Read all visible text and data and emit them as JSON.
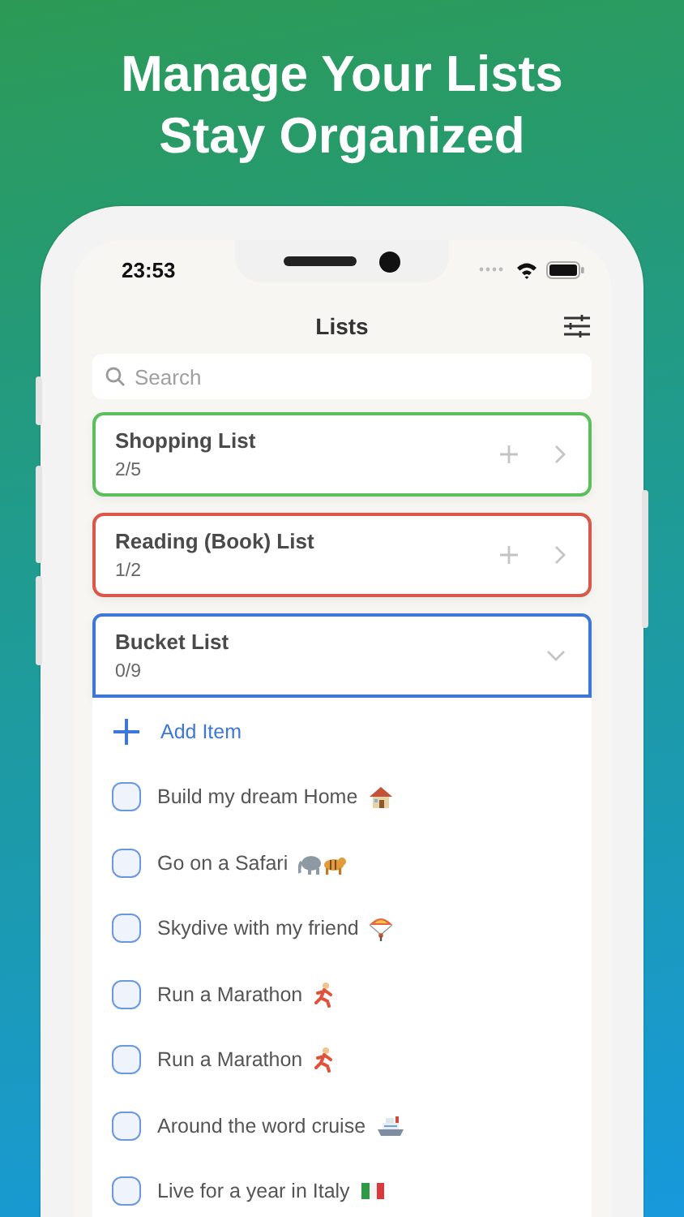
{
  "headline": [
    "Manage Your Lists",
    "Stay Organized"
  ],
  "status_bar": {
    "time": "23:53"
  },
  "nav": {
    "title": "Lists"
  },
  "search": {
    "placeholder": "Search"
  },
  "lists": [
    {
      "name": "Shopping List",
      "progress": "2/5",
      "color": "#5cbf5c",
      "expanded": false
    },
    {
      "name": "Reading (Book) List",
      "progress": "1/2",
      "color": "#d9584a",
      "expanded": false
    },
    {
      "name": "Bucket List",
      "progress": "0/9",
      "color": "#3d78d8",
      "expanded": true,
      "add_label": "Add Item",
      "items": [
        {
          "text": "Build my dream Home",
          "checked": false
        },
        {
          "text": "Go on a Safari",
          "checked": false
        },
        {
          "text": "Skydive with my friend",
          "checked": false
        },
        {
          "text": "Run a Marathon",
          "checked": false
        },
        {
          "text": "Run a Marathon",
          "checked": false
        },
        {
          "text": "Around the word cruise",
          "checked": false
        },
        {
          "text": "Live for a year in Italy",
          "checked": false
        }
      ]
    }
  ]
}
